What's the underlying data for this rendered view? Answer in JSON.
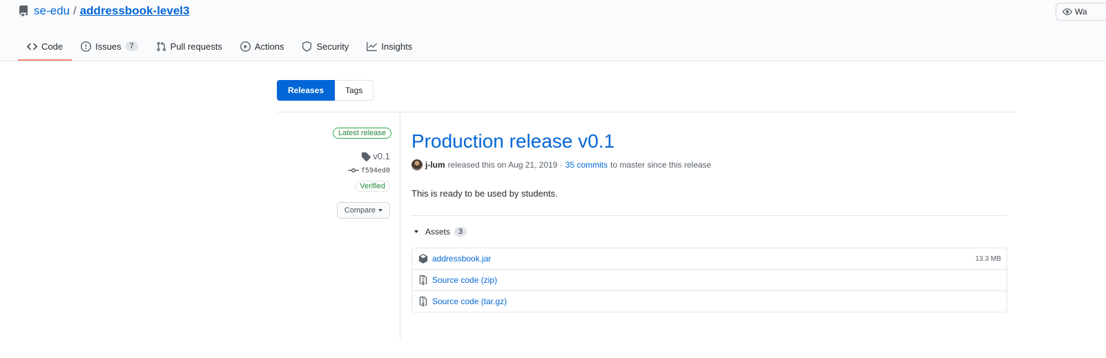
{
  "repo": {
    "owner": "se-edu",
    "separator": "/",
    "name": "addressbook-level3"
  },
  "watch": {
    "label": "Wa"
  },
  "tabs": [
    {
      "label": "Code",
      "icon": "code-icon",
      "active": true
    },
    {
      "label": "Issues",
      "icon": "issue-opened-icon",
      "count": "7"
    },
    {
      "label": "Pull requests",
      "icon": "git-pull-request-icon"
    },
    {
      "label": "Actions",
      "icon": "play-icon"
    },
    {
      "label": "Security",
      "icon": "shield-icon"
    },
    {
      "label": "Insights",
      "icon": "graph-icon"
    }
  ],
  "subnav": {
    "releases": "Releases",
    "tags": "Tags"
  },
  "release_meta": {
    "latest_badge": "Latest release",
    "tag": "v0.1",
    "commit": "f594ed0",
    "verified": "Verified",
    "compare": "Compare"
  },
  "release": {
    "title": "Production release v0.1",
    "author": "j-lum",
    "released_text": "released this on Aug 21, 2019 ·",
    "commits_link": "35 commits",
    "since_text": "to master since this release",
    "body": "This is ready to be used by students."
  },
  "assets": {
    "label": "Assets",
    "count": "3",
    "items": [
      {
        "name": "addressbook.jar",
        "format": "",
        "size": "13.3 MB",
        "icon": "package-icon"
      },
      {
        "name": "Source code",
        "format": "(zip)",
        "size": "",
        "icon": "file-zip-icon"
      },
      {
        "name": "Source code",
        "format": "(tar.gz)",
        "size": "",
        "icon": "file-zip-icon"
      }
    ]
  },
  "colors": {
    "accent": "#0366d6",
    "active_tab_underline": "#f9826c",
    "badge_green": "#28a745"
  }
}
